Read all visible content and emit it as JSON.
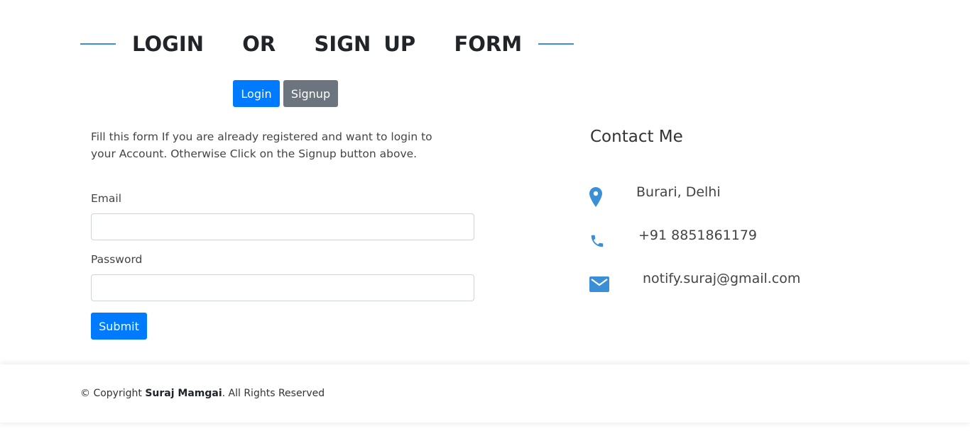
{
  "header": {
    "title": "LOGIN   OR   SIGN UP   FORM"
  },
  "toggle": {
    "login_label": "Login",
    "signup_label": "Signup"
  },
  "form": {
    "intro": "Fill this form If you are already registered and want to login to your Account. Otherwise Click on the Signup button above.",
    "email_label": "Email",
    "email_value": "",
    "password_label": "Password",
    "password_value": "",
    "submit_label": "Submit"
  },
  "contact": {
    "title": "Contact Me",
    "address": "Burari, Delhi",
    "phone": "+91 8851861179",
    "email": "notify.suraj@gmail.com",
    "icon_color": "#3a8fd6"
  },
  "footer": {
    "prefix": "© Copyright ",
    "name": "Suraj Mamgai",
    "suffix": ". All Rights Reserved"
  },
  "colors": {
    "primary": "#007bff",
    "secondary": "#6c757d",
    "accent_line": "#3a8fd6"
  }
}
